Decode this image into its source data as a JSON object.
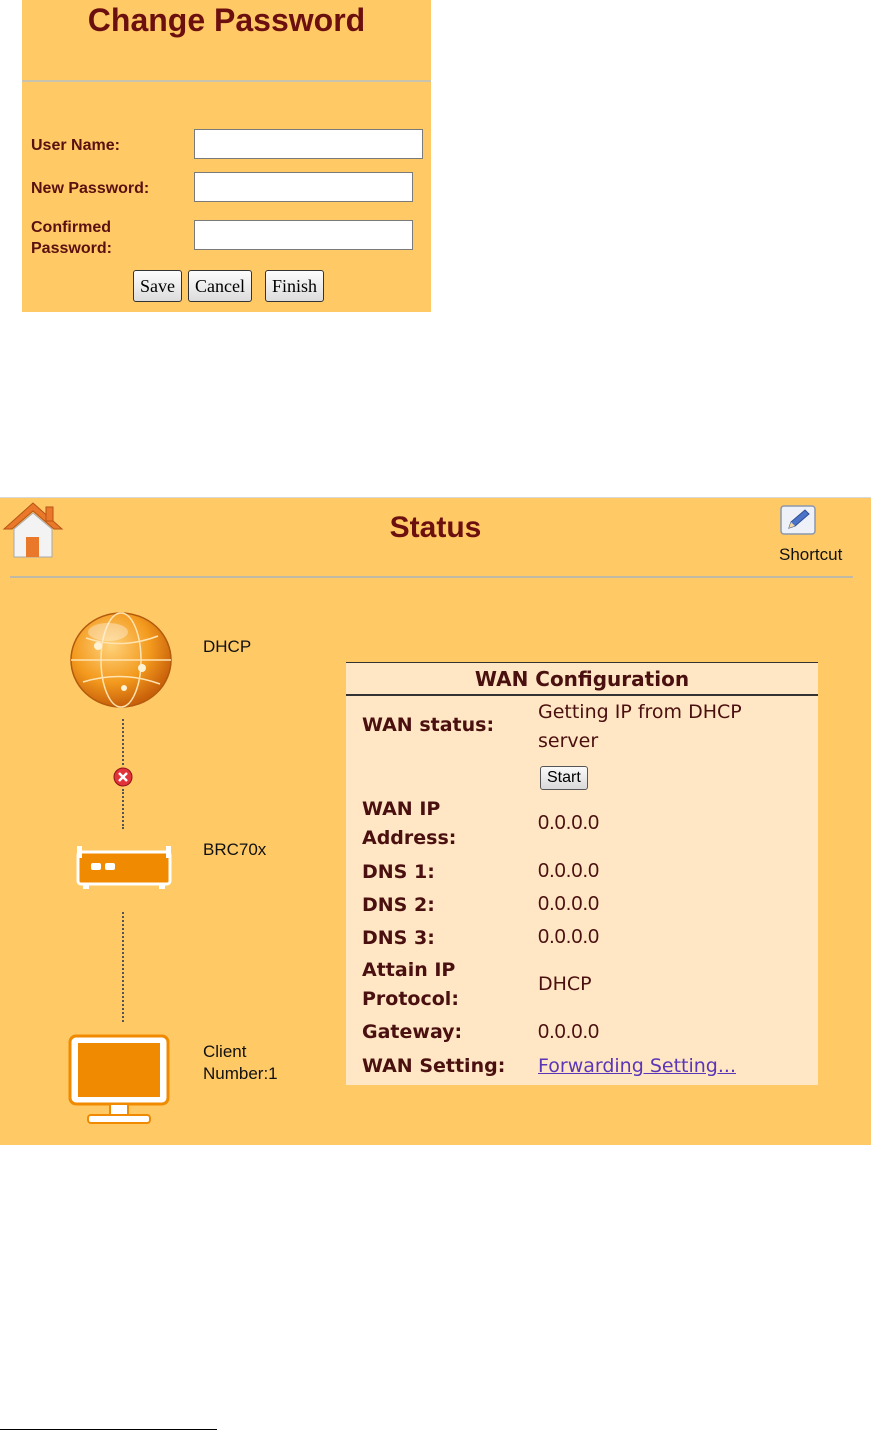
{
  "change_password": {
    "title": "Change Password",
    "fields": [
      {
        "label": "User Name:",
        "value": "",
        "placeholder": ""
      },
      {
        "label": "New Password:",
        "value": "",
        "placeholder": ""
      },
      {
        "label": "Confirmed Password:",
        "value": "",
        "placeholder": ""
      }
    ],
    "buttons": {
      "save": "Save",
      "cancel": "Cancel",
      "finish": "Finish"
    }
  },
  "status": {
    "title": "Status",
    "shortcut_label": "Shortcut",
    "icons": {
      "home": "home-icon",
      "shortcut": "pencil-edit-icon",
      "internet": "globe-icon",
      "link_status": "error-x-icon",
      "router": "router-icon",
      "client": "monitor-icon"
    },
    "nodes": {
      "internet_label": "DHCP",
      "router_label": "BRC70x",
      "client_label": "Client Number:1"
    },
    "wan": {
      "header": "WAN Configuration",
      "status_label": "WAN status:",
      "status_value": "Getting IP from DHCP server",
      "start_button": "Start",
      "ip_label": "WAN IP Address:",
      "ip_value": "0.0.0.0",
      "dns1_label": "DNS 1:",
      "dns1_value": "0.0.0.0",
      "dns2_label": "DNS 2:",
      "dns2_value": "0.0.0.0",
      "dns3_label": "DNS 3:",
      "dns3_value": "0.0.0.0",
      "protocol_label": "Attain IP Protocol:",
      "protocol_value": "DHCP",
      "gateway_label": "Gateway:",
      "gateway_value": "0.0.0.0",
      "setting_label": "WAN Setting:",
      "setting_link": "Forwarding Setting..."
    }
  },
  "colors": {
    "panel_bg": "#ffc966",
    "title_color": "#6b0f0f",
    "wan_bg": "#ffe6c4",
    "icon_orange": "#f08a00",
    "link_color": "#5a36b8"
  }
}
